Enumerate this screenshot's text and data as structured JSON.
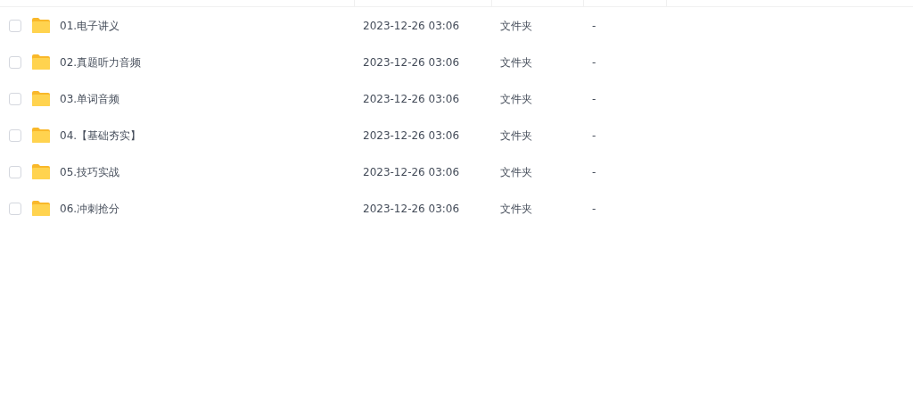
{
  "rows": [
    {
      "name": "01.电子讲义",
      "modified": "2023-12-26 03:06",
      "type": "文件夹",
      "size": "-",
      "checked": false
    },
    {
      "name": "02.真题听力音频",
      "modified": "2023-12-26 03:06",
      "type": "文件夹",
      "size": "-",
      "checked": false
    },
    {
      "name": "03.单词音频",
      "modified": "2023-12-26 03:06",
      "type": "文件夹",
      "size": "-",
      "checked": false
    },
    {
      "name": "04.【基础夯实】",
      "modified": "2023-12-26 03:06",
      "type": "文件夹",
      "size": "-",
      "checked": false
    },
    {
      "name": "05.技巧实战",
      "modified": "2023-12-26 03:06",
      "type": "文件夹",
      "size": "-",
      "checked": false
    },
    {
      "name": "06.冲刺抢分",
      "modified": "2023-12-26 03:06",
      "type": "文件夹",
      "size": "-",
      "checked": false
    }
  ]
}
